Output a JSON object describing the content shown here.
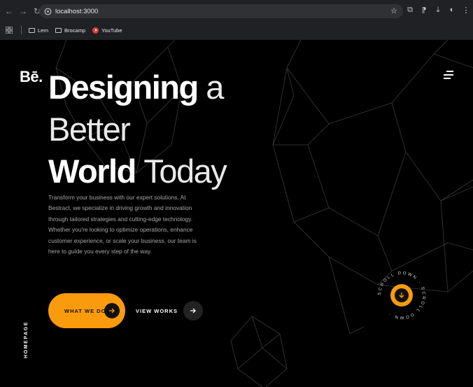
{
  "browser": {
    "url": "localhost:3000",
    "bookmarks": [
      {
        "label": "Lern"
      },
      {
        "label": "Brocamp"
      },
      {
        "label": "YouTube"
      }
    ]
  },
  "site": {
    "logo": "Bē.",
    "headline": {
      "line1_bold": "Designing",
      "line1_light": "a Better",
      "line2_bold": "World",
      "line2_light": "Today"
    },
    "description": "Transform your business with our expert solutions. At Bestract, we specialize in driving growth and innovation through tailored strategies and cutting-edge technology. Whether you're looking to optimize operations, enhance customer experience, or scale your business, our team is here to guide you every step of the way.",
    "primary_button": "WHAT WE DO",
    "secondary_button": "VIEW WORKS",
    "side_label": "HOMEPAGE",
    "scroll_text": "SCROLL DOWN · SCROLL DOWN · ",
    "accent_color": "#f99b0c"
  }
}
